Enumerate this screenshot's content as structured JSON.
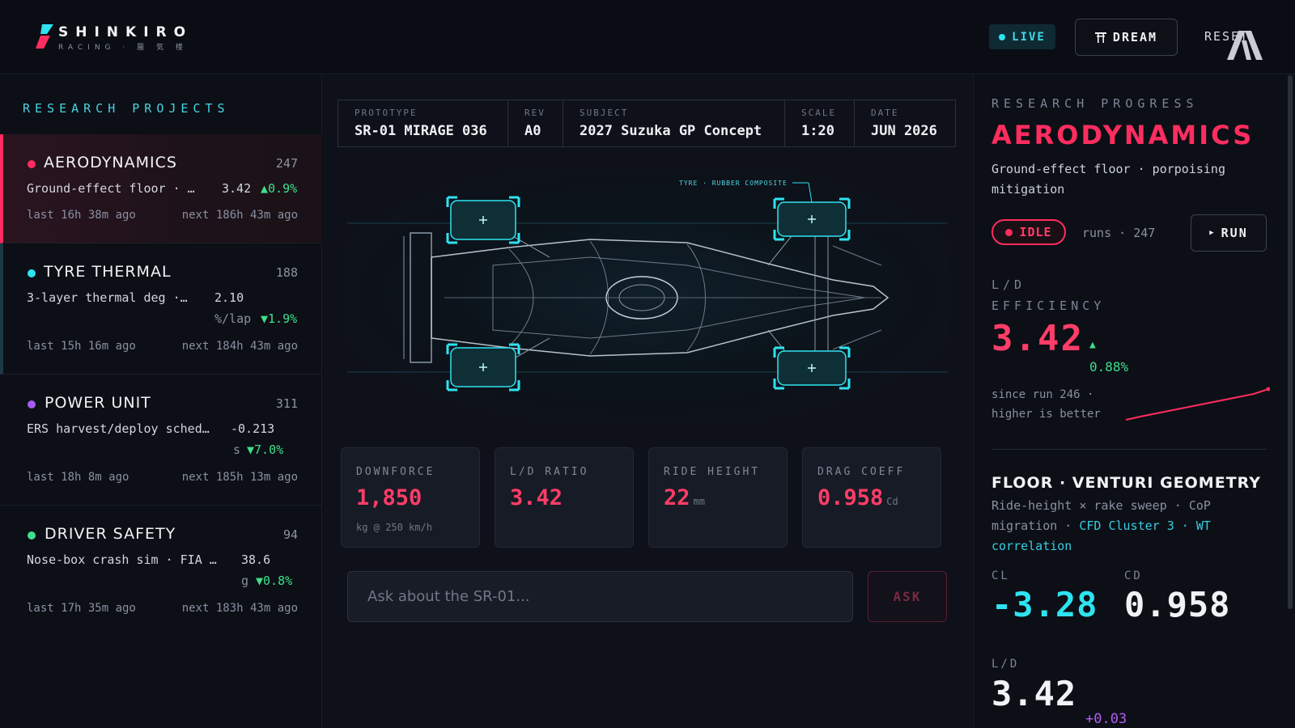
{
  "header": {
    "brand_name": "SHINKIRO",
    "brand_sub": "RACING · 蜃 気 楼",
    "live_label": "LIVE",
    "dream_label": "DREAM",
    "reset_label": "RESET"
  },
  "sidebar": {
    "title": "RESEARCH PROJECTS",
    "projects": [
      {
        "name": "AERODYNAMICS",
        "count": "247",
        "desc": "Ground-effect floor · …",
        "value": "3.42",
        "unit": "",
        "delta": "▲0.9%",
        "last": "last 16h 38m ago",
        "next": "next 186h 43m ago",
        "color": "#ff2d5f"
      },
      {
        "name": "TYRE THERMAL",
        "count": "188",
        "desc": "3-layer thermal deg ·…",
        "value": "2.10",
        "unit": "%/lap",
        "delta": "▼1.9%",
        "last": "last 15h 16m ago",
        "next": "next 184h 43m ago",
        "color": "#2ee3f0"
      },
      {
        "name": "POWER UNIT",
        "count": "311",
        "desc": "ERS harvest/deploy sched…",
        "value": "-0.213",
        "unit": "s",
        "delta": "▼7.0%",
        "last": "last 18h 8m ago",
        "next": "next 185h 13m ago",
        "color": "#a65cf0"
      },
      {
        "name": "DRIVER SAFETY",
        "count": "94",
        "desc": "Nose-box crash sim · FIA …",
        "value": "38.6",
        "unit": "g",
        "delta": "▼0.8%",
        "last": "last 17h 35m ago",
        "next": "next 183h 43m ago",
        "color": "#3ee08a"
      }
    ]
  },
  "spec": {
    "cells": [
      {
        "label": "PROTOTYPE",
        "value": "SR-01 MIRAGE 036"
      },
      {
        "label": "REV",
        "value": "A0"
      },
      {
        "label": "SUBJECT",
        "value": "2027 Suzuka GP Concept"
      },
      {
        "label": "SCALE",
        "value": "1:20"
      },
      {
        "label": "DATE",
        "value": "JUN 2026"
      }
    ]
  },
  "stage": {
    "callout": "TYRE · RUBBER COMPOSITE"
  },
  "metrics": [
    {
      "label": "DOWNFORCE",
      "value": "1,850",
      "unit": "",
      "sub": "kg @ 250 km/h"
    },
    {
      "label": "L/D RATIO",
      "value": "3.42",
      "unit": "",
      "sub": ""
    },
    {
      "label": "RIDE HEIGHT",
      "value": "22",
      "unit": "mm",
      "sub": ""
    },
    {
      "label": "DRAG COEFF",
      "value": "0.958",
      "unit": "Cd",
      "sub": ""
    }
  ],
  "ask": {
    "placeholder": "Ask about the SR-01...",
    "button": "ASK"
  },
  "right": {
    "heading": "RESEARCH PROGRESS",
    "title": "AERODYNAMICS",
    "desc": "Ground-effect floor · porpoising mitigation",
    "status": "IDLE",
    "runs": "runs · 247",
    "run_label": "RUN",
    "eff_label_1": "L/D",
    "eff_label_2": "EFFICIENCY",
    "eff_value": "3.42",
    "eff_arrow": "▲",
    "eff_delta": "0.88%",
    "eff_note_1": "since run 246 ·",
    "eff_note_2": "higher is better",
    "floor_title": "FLOOR · VENTURI GEOMETRY",
    "floor_desc_plain": "Ride-height × rake sweep · CoP migration · ",
    "floor_desc_hl": "CFD Cluster 3 · WT correlation",
    "cl_label": "CL",
    "cl_value": "-3.28",
    "cd_label": "CD",
    "cd_value": "0.958",
    "ld_label": "L/D",
    "ld_value": "3.42",
    "ld_delta": "+0.03",
    "accent": "#ff2d5f",
    "cyan": "#37cde0"
  }
}
